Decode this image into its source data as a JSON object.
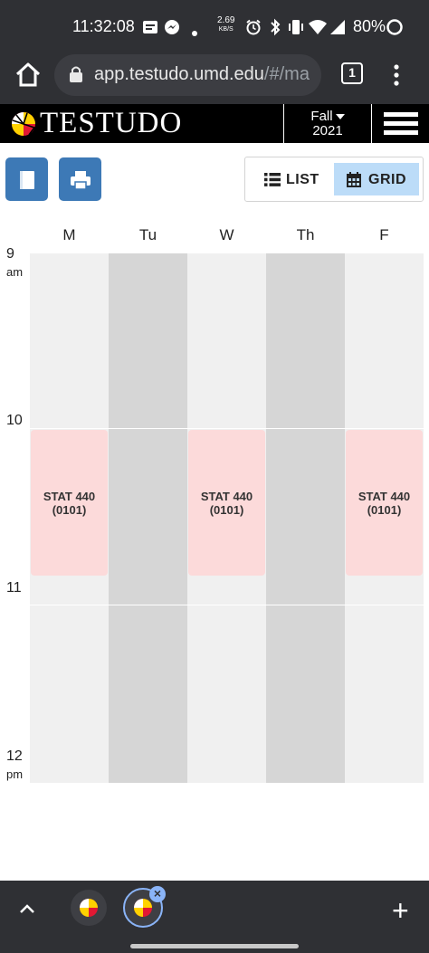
{
  "status_bar": {
    "time": "11:32:08",
    "net_speed_value": "2.69",
    "net_speed_unit": "KB/S",
    "battery": "80%"
  },
  "browser": {
    "url_main": "app.testudo.umd.edu",
    "url_rest": "/#/ma",
    "tab_count": "1"
  },
  "site": {
    "brand": "TESTUDO",
    "term_season": "Fall",
    "term_year": "2021"
  },
  "toolbar": {
    "list_label": "LIST",
    "grid_label": "GRID",
    "active_view": "grid"
  },
  "schedule": {
    "days": [
      "M",
      "Tu",
      "W",
      "Th",
      "F"
    ],
    "times": [
      {
        "hour": "9",
        "period": "am"
      },
      {
        "hour": "10",
        "period": ""
      },
      {
        "hour": "11",
        "period": ""
      },
      {
        "hour": "12",
        "period": "pm"
      }
    ],
    "events": [
      {
        "day": "M",
        "course": "STAT 440",
        "section": "(0101)"
      },
      {
        "day": "W",
        "course": "STAT 440",
        "section": "(0101)"
      },
      {
        "day": "F",
        "course": "STAT 440",
        "section": "(0101)"
      }
    ]
  },
  "colors": {
    "accent_blue": "#3d79b6",
    "event_bg": "#fcdada",
    "active_toggle": "#bcdcf8"
  }
}
